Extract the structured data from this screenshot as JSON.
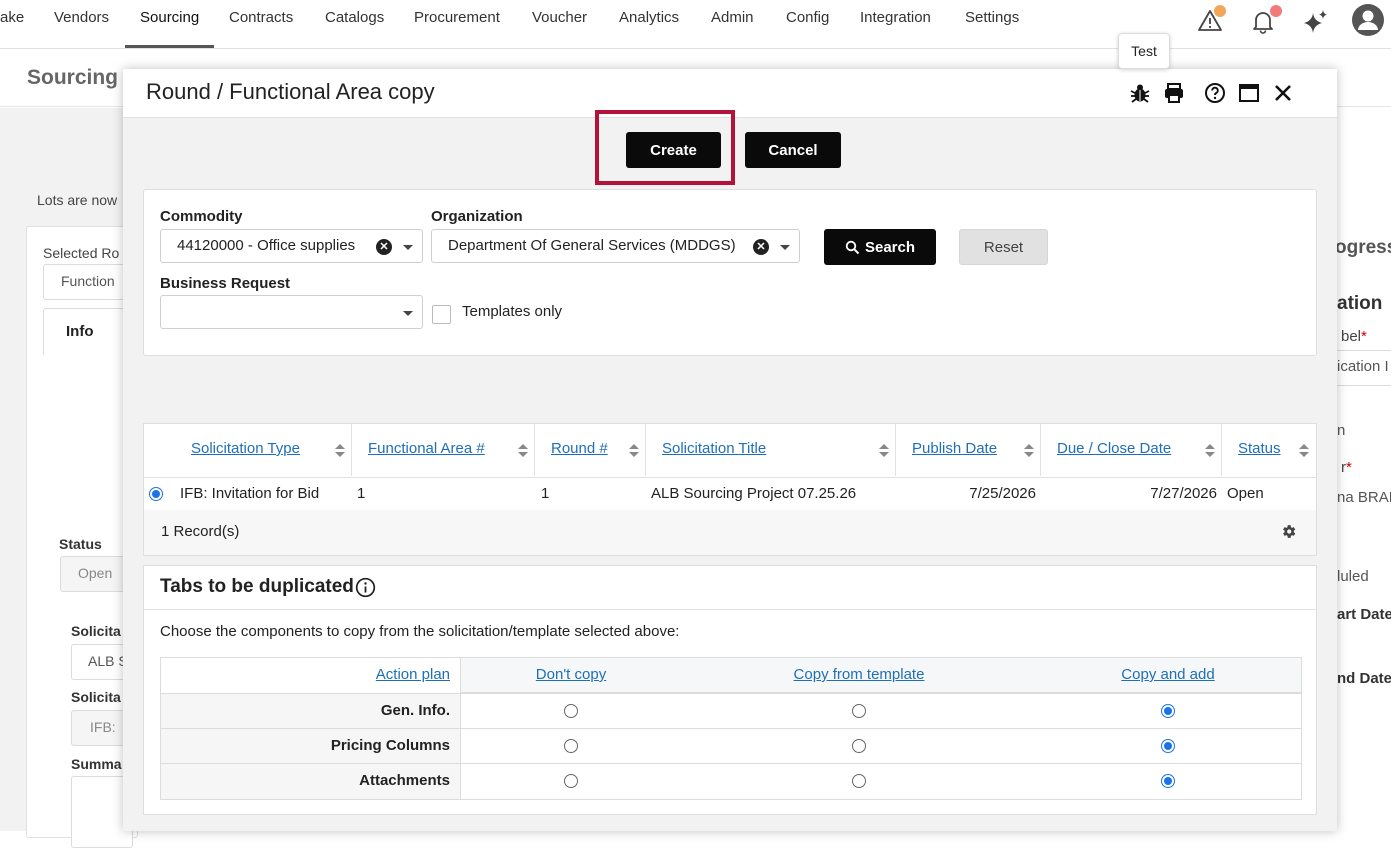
{
  "nav": {
    "items": [
      "ake",
      "Vendors",
      "Sourcing",
      "Contracts",
      "Catalogs",
      "Procurement",
      "Voucher",
      "Analytics",
      "Admin",
      "Config",
      "Integration",
      "Settings"
    ],
    "active": "Sourcing",
    "icons": [
      "alert-triangle-icon",
      "bell-icon",
      "sparkle-icon",
      "user-avatar-icon"
    ],
    "badge_color": "#f28b82"
  },
  "background": {
    "page_title": "Sourcing P",
    "lots_notice": "Lots are now",
    "selected_label": "Selected Ro",
    "selected_value": "Function",
    "info_tab": "Info",
    "status_label": "Status",
    "status_value": "Open",
    "solicitation_label_1": "Solicita",
    "solicitation_value_1": "ALB S",
    "solicitation_label_2": "Solicita",
    "solicitation_value_2": "IFB: ",
    "summary_label": "Summa",
    "right_progress": "ogress",
    "right_section": "ation",
    "right_label_1": "bel",
    "right_value_1": "ication I",
    "right_value_2": "n",
    "right_label_2": "r",
    "right_value_3": "na BRAD",
    "right_value_4": "luled",
    "right_label_3": "art Date",
    "right_label_4": "nd Date"
  },
  "tooltip": "Test",
  "modal": {
    "title": "Round / Functional Area copy",
    "header_icons": [
      "bug-icon",
      "print-icon",
      "help-icon",
      "maximize-icon",
      "close-icon"
    ],
    "create_label": "Create",
    "cancel_label": "Cancel",
    "filters": {
      "commodity_label": "Commodity",
      "commodity_value": "44120000 - Office supplies",
      "organization_label": "Organization",
      "organization_value": "Department Of General Services (MDDGS)",
      "business_request_label": "Business Request",
      "business_request_value": "",
      "templates_only_label": "Templates only",
      "search_label": "Search",
      "reset_label": "Reset"
    },
    "table": {
      "columns": [
        "Solicitation Type",
        "Functional Area #",
        "Round #",
        "Solicitation Title",
        "Publish Date",
        "Due / Close Date",
        "Status"
      ],
      "rows": [
        [
          "IFB: Invitation for Bid",
          "1",
          "1",
          "ALB Sourcing Project 07.25.26",
          "7/25/2026",
          "7/27/2026",
          "Open"
        ]
      ],
      "record_count": "1 Record(s)"
    },
    "tabs_section": {
      "title": "Tabs to be duplicated",
      "instruction": "Choose the components to copy from the solicitation/template selected above:",
      "headers": [
        "Action plan",
        "Don't copy",
        "Copy from template",
        "Copy and add"
      ],
      "rows": [
        {
          "label": "Gen. Info.",
          "selected": "Copy and add"
        },
        {
          "label": "Pricing Columns",
          "selected": "Copy and add"
        },
        {
          "label": "Attachments",
          "selected": "Copy and add"
        }
      ]
    }
  },
  "colors": {
    "highlight": "#b5123a",
    "link": "#1e6fb8",
    "primary_button": "#0a0a0a"
  }
}
